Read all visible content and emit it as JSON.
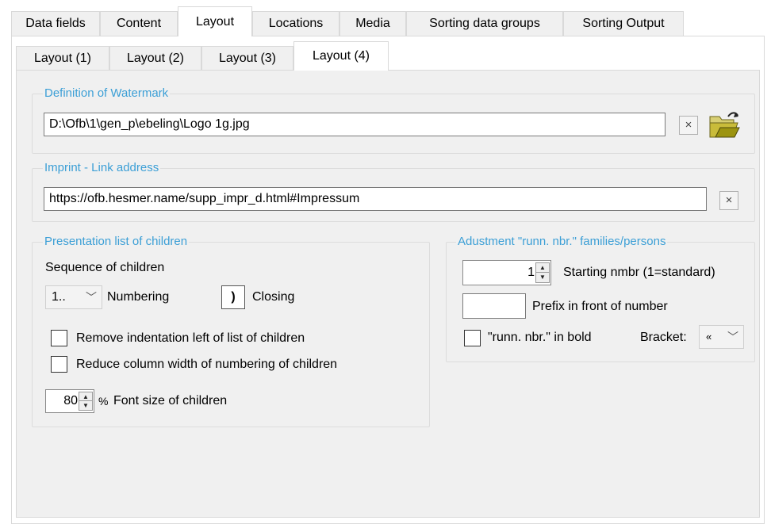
{
  "tabs_main": [
    "Data fields",
    "Content",
    "Layout",
    "Locations",
    "Media",
    "Sorting data groups",
    "Sorting Output"
  ],
  "tabs_sub": [
    "Layout (1)",
    "Layout (2)",
    "Layout (3)",
    "Layout (4)"
  ],
  "watermark": {
    "legend": "Definition of Watermark",
    "path": "D:\\Ofb\\1\\gen_p\\ebeling\\Logo 1g.jpg",
    "clear_glyph": "×"
  },
  "imprint": {
    "legend": "Imprint - Link address",
    "url": "https://ofb.hesmer.name/supp_impr_d.html#Impressum",
    "clear_glyph": "×"
  },
  "children": {
    "legend": "Presentation list of children",
    "sequence_label": "Sequence of children",
    "numbering_value": "1..",
    "numbering_label": "Numbering",
    "closing_value": ")",
    "closing_label": "Closing",
    "remove_indent_label": "Remove indentation left of list of children",
    "reduce_width_label": "Reduce column width of numbering of children",
    "font_size_value": "80",
    "percent": "%",
    "font_size_label": "Font size of children"
  },
  "adjustment": {
    "legend": "Adustment \"runn. nbr.\" families/persons",
    "start_value": "1",
    "start_label": "Starting nmbr (1=standard)",
    "prefix_value": "",
    "prefix_label": "Prefix in front of number",
    "bold_label": "\"runn. nbr.\" in bold",
    "bracket_label": "Bracket:",
    "bracket_value": "«"
  },
  "colors": {
    "legend": "#3c9fd6",
    "panel": "#f0f0f0",
    "tab_border": "#d9d9d9"
  }
}
